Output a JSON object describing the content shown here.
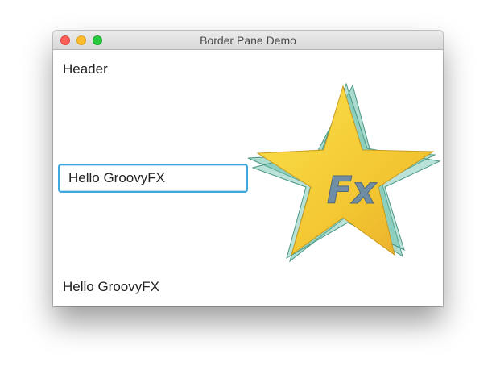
{
  "window": {
    "title": "Border Pane Demo",
    "controls": [
      "close-button",
      "minimize-button",
      "zoom-button"
    ]
  },
  "pane": {
    "header": "Header",
    "center_input_value": "Hello GroovyFX",
    "footer": "Hello GroovyFX",
    "logo": {
      "text": "Fx",
      "colors": {
        "star": "#f2c531",
        "shadow_stars": "#68bfa8",
        "text": "#6f8ea5"
      }
    }
  },
  "colors": {
    "focus_ring": "#3fa9dd",
    "close": "#fc5f57",
    "minimize": "#fdbc2e",
    "zoom": "#28c840"
  }
}
